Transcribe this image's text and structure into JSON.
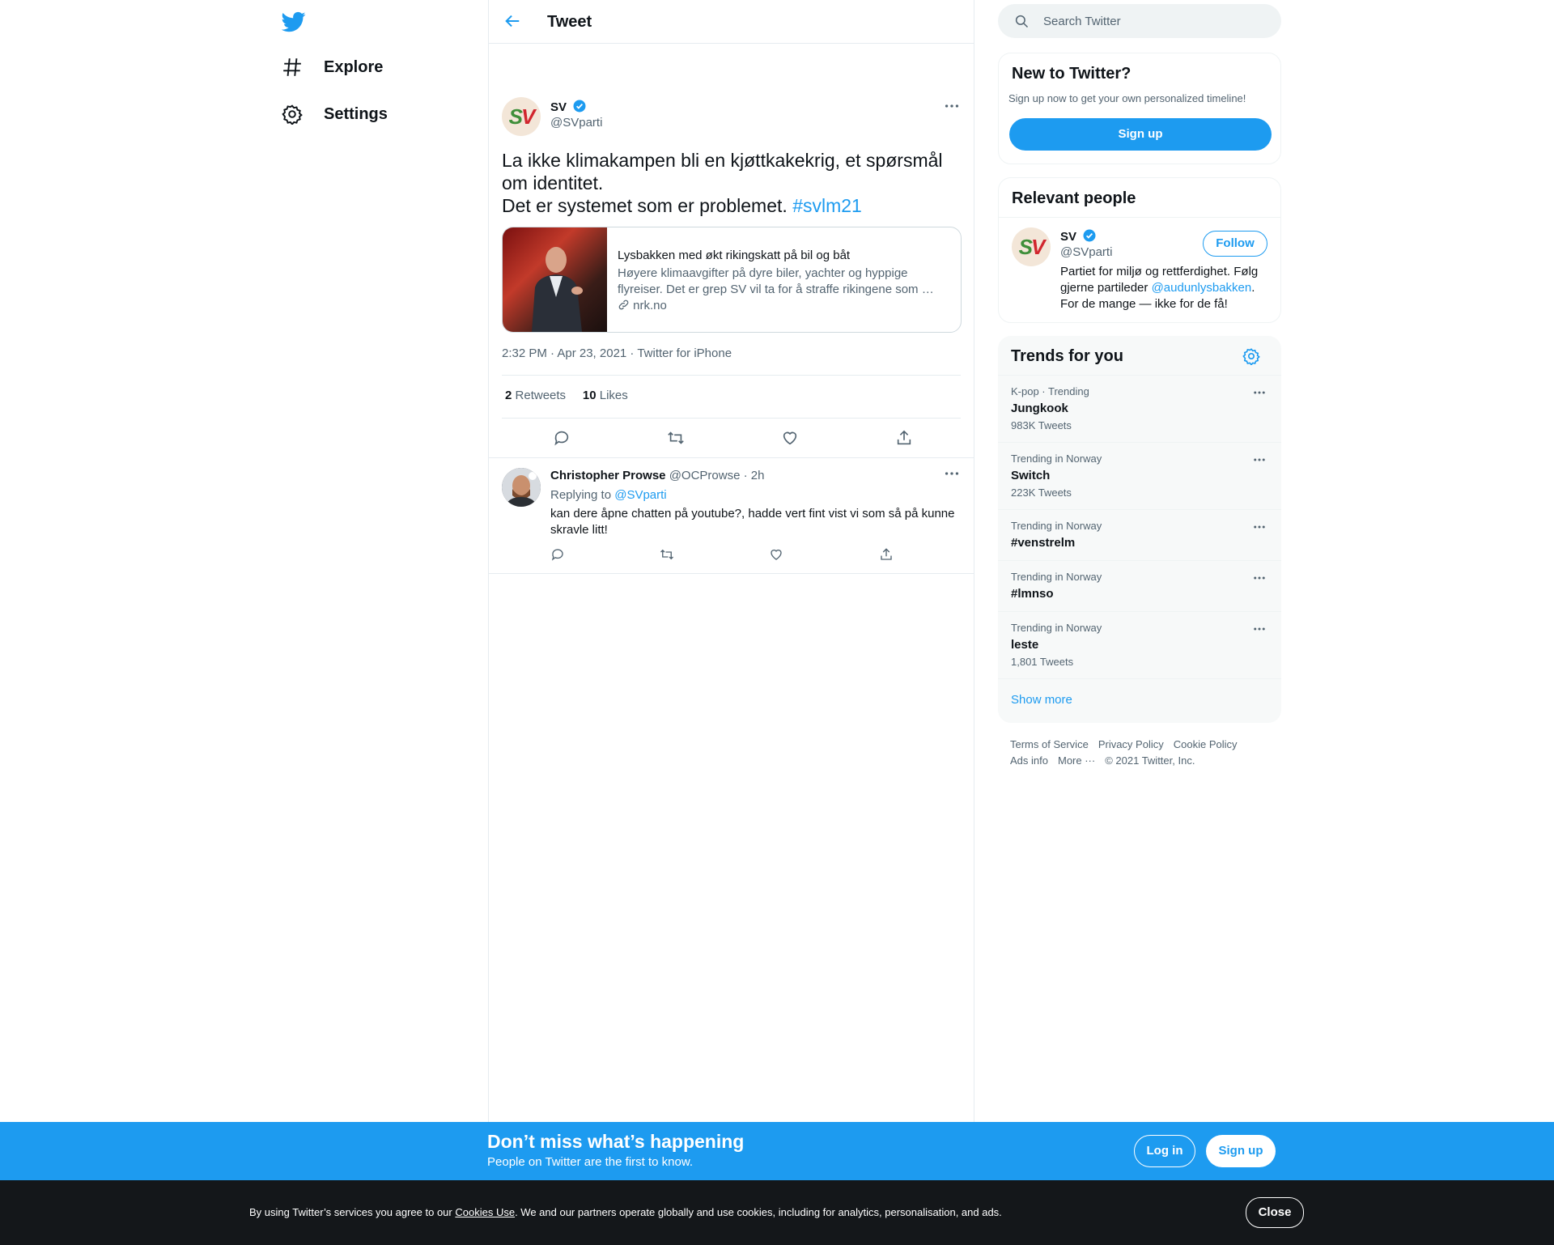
{
  "nav": {
    "items": [
      {
        "label": "Explore"
      },
      {
        "label": "Settings"
      }
    ]
  },
  "header": {
    "title": "Tweet"
  },
  "tweet": {
    "author_name": "SV",
    "author_handle": "@SVparti",
    "text_line1": "La ikke klimakampen bli en kjøttkakekrig, et spørsmål om identitet.",
    "text_line2": "Det er systemet som er problemet. ",
    "hashtag": "#svlm21",
    "card": {
      "title": "Lysbakken med økt rikingskatt på bil og båt",
      "description": "Høyere klimaavgifter på dyre biler, yachter og hyppige flyreiser. Det er grep SV vil ta for å straffe rikingene som …",
      "url": "nrk.no"
    },
    "meta": "2:32 PM · Apr 23, 2021 · Twitter for iPhone",
    "retweets_count": "2",
    "retweets_label": "Retweets",
    "likes_count": "10",
    "likes_label": "Likes"
  },
  "reply": {
    "author_name": "Christopher Prowse",
    "author_handle": "@OCProwse",
    "time": "· 2h",
    "replying_prefix": "Replying to ",
    "replying_to": "@SVparti",
    "text": "kan dere åpne chatten på youtube?, hadde vert fint vist vi som så på kunne skravle litt!"
  },
  "search": {
    "placeholder": "Search Twitter"
  },
  "new_to_twitter": {
    "title": "New to Twitter?",
    "subtitle": "Sign up now to get your own personalized timeline!",
    "button": "Sign up"
  },
  "relevant": {
    "title": "Relevant people",
    "name": "SV",
    "handle": "@SVparti",
    "follow": "Follow",
    "bio_1": "Partiet for miljø og rettferdighet. Følg gjerne partileder ",
    "bio_mention": "@audunlysbakken",
    "bio_2": ".",
    "bio_3": "For de mange — ikke for de få!"
  },
  "trends": {
    "title": "Trends for you",
    "items": [
      {
        "context": "K-pop · Trending",
        "name": "Jungkook",
        "count": "983K Tweets"
      },
      {
        "context": "Trending in Norway",
        "name": "Switch",
        "count": "223K Tweets"
      },
      {
        "context": "Trending in Norway",
        "name": "#venstrelm",
        "count": ""
      },
      {
        "context": "Trending in Norway",
        "name": "#lmnso",
        "count": ""
      },
      {
        "context": "Trending in Norway",
        "name": "leste",
        "count": "1,801 Tweets"
      }
    ],
    "show_more": "Show more"
  },
  "footer": {
    "links": [
      "Terms of Service",
      "Privacy Policy",
      "Cookie Policy",
      "Ads info",
      "More ···"
    ],
    "copyright": "© 2021 Twitter, Inc."
  },
  "banner": {
    "title": "Don’t miss what’s happening",
    "subtitle": "People on Twitter are the first to know.",
    "login": "Log in",
    "signup": "Sign up"
  },
  "cookie": {
    "text_1": "By using Twitter’s services you agree to our ",
    "link": "Cookies Use",
    "text_2": ". We and our partners operate globally and use cookies, including for analytics, personalisation, and ads.",
    "close": "Close"
  },
  "colors": {
    "accent": "#1d9bf0",
    "banner": "#1d9bf0",
    "cookie_bg": "#14171a"
  }
}
